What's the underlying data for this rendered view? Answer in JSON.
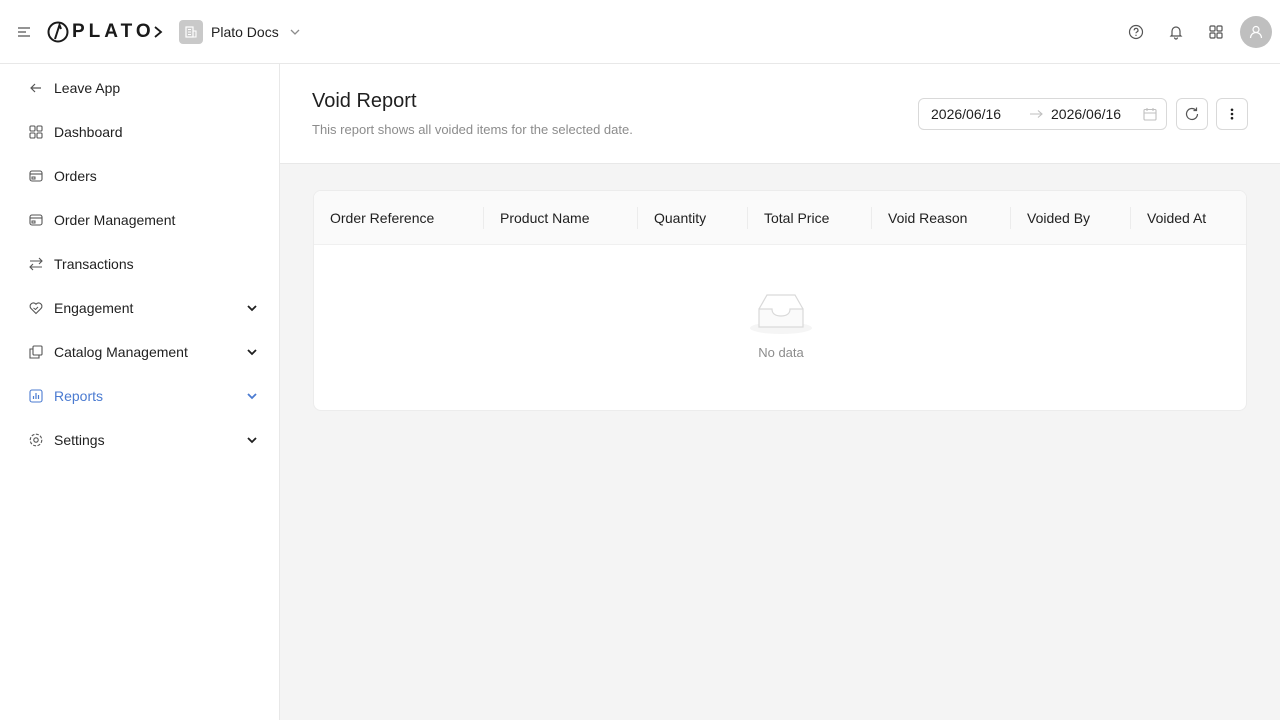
{
  "brand": {
    "logo_text": "PLATO"
  },
  "workspace": {
    "name": "Plato Docs"
  },
  "sidebar": {
    "items": [
      {
        "label": "Leave App"
      },
      {
        "label": "Dashboard"
      },
      {
        "label": "Orders"
      },
      {
        "label": "Order Management"
      },
      {
        "label": "Transactions"
      },
      {
        "label": "Engagement"
      },
      {
        "label": "Catalog Management"
      },
      {
        "label": "Reports"
      },
      {
        "label": "Settings"
      }
    ],
    "active_color": "#4b7bd1"
  },
  "page": {
    "title": "Void Report",
    "subtitle": "This report shows all voided items for the selected date."
  },
  "date_range": {
    "start": "2026/06/16",
    "end": "2026/06/16"
  },
  "table": {
    "columns": [
      "Order Reference",
      "Product Name",
      "Quantity",
      "Total Price",
      "Void Reason",
      "Voided By",
      "Voided At"
    ],
    "empty_text": "No data"
  }
}
